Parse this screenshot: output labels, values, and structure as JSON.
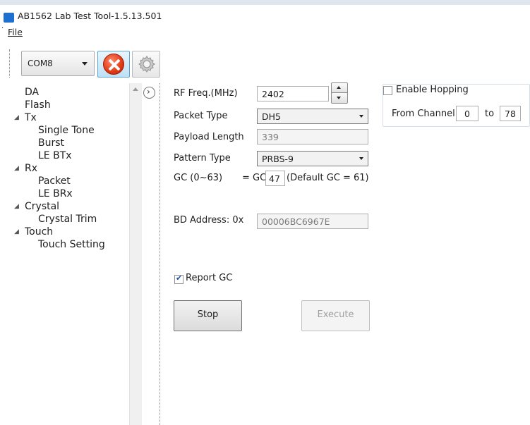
{
  "window": {
    "title": "AB1562 Lab Test Tool-1.5.13.501"
  },
  "menu": {
    "file_label": "File"
  },
  "toolbar": {
    "com_port": "COM8"
  },
  "tree": {
    "items": [
      {
        "label": "DA"
      },
      {
        "label": "Flash"
      },
      {
        "label": "Tx"
      },
      {
        "label": "Single Tone"
      },
      {
        "label": "Burst"
      },
      {
        "label": "LE BTx"
      },
      {
        "label": "Rx"
      },
      {
        "label": "Packet"
      },
      {
        "label": "LE BRx"
      },
      {
        "label": "Crystal"
      },
      {
        "label": "Crystal Trim"
      },
      {
        "label": "Touch"
      },
      {
        "label": "Touch Setting"
      }
    ]
  },
  "form": {
    "rf_freq_label": "RF Freq.(MHz)",
    "rf_freq_value": "2402",
    "packet_type_label": "Packet Type",
    "packet_type_value": "DH5",
    "payload_length_label": "Payload Length",
    "payload_length_value": "339",
    "pattern_type_label": "Pattern Type",
    "pattern_type_value": "PRBS-9",
    "gc_label": "GC (0~63)",
    "gc_eq_label": "= GC",
    "gc_value": "47",
    "gc_default_note": "(Default GC = 61)",
    "bd_address_label": "BD Address: 0x",
    "bd_address_value": "00006BC6967E",
    "report_gc_label": "Report GC",
    "report_gc_checked": true,
    "stop_label": "Stop",
    "execute_label": "Execute"
  },
  "hopping": {
    "enable_label": "Enable Hopping",
    "enabled": false,
    "from_channel_label": "From Channel",
    "from_value": "0",
    "to_label": "to",
    "to_value": "78"
  },
  "colors": {
    "accent": "#5fa3d4",
    "disconnect_red": "#e03a15",
    "app_icon": "#1f6fd1"
  }
}
